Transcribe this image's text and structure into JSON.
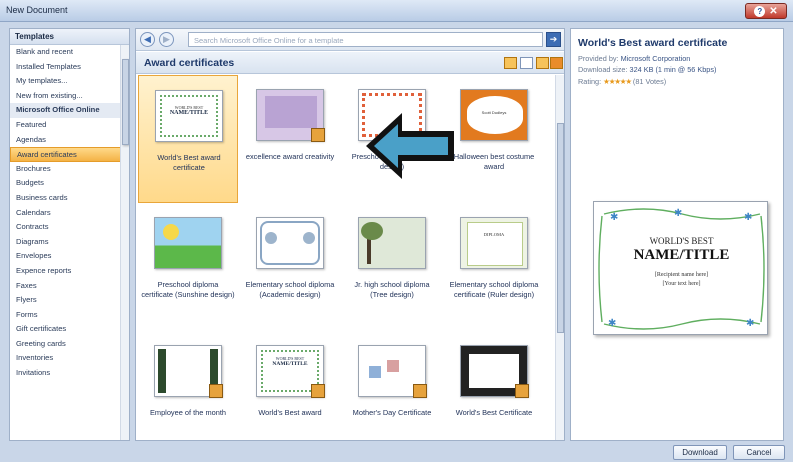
{
  "window": {
    "title": "New Document"
  },
  "sidebar": {
    "header": "Templates",
    "items": [
      {
        "label": "Blank and recent",
        "state": ""
      },
      {
        "label": "Installed Templates",
        "state": ""
      },
      {
        "label": "My templates...",
        "state": ""
      },
      {
        "label": "New from existing...",
        "state": ""
      },
      {
        "label": "Microsoft Office Online",
        "state": "bold"
      },
      {
        "label": "Featured",
        "state": ""
      },
      {
        "label": "Agendas",
        "state": ""
      },
      {
        "label": "Award certificates",
        "state": "sel"
      },
      {
        "label": "Brochures",
        "state": ""
      },
      {
        "label": "Budgets",
        "state": ""
      },
      {
        "label": "Business cards",
        "state": ""
      },
      {
        "label": "Calendars",
        "state": ""
      },
      {
        "label": "Contracts",
        "state": ""
      },
      {
        "label": "Diagrams",
        "state": ""
      },
      {
        "label": "Envelopes",
        "state": ""
      },
      {
        "label": "Expence reports",
        "state": ""
      },
      {
        "label": "Faxes",
        "state": ""
      },
      {
        "label": "Flyers",
        "state": ""
      },
      {
        "label": "Forms",
        "state": ""
      },
      {
        "label": "Gift certificates",
        "state": ""
      },
      {
        "label": "Greeting cards",
        "state": ""
      },
      {
        "label": "Inventories",
        "state": ""
      },
      {
        "label": "Invitations",
        "state": ""
      }
    ]
  },
  "search": {
    "back_icon": "back-arrow-icon",
    "forward_icon": "forward-arrow-icon",
    "placeholder": "Search Microsoft Office Online for a template",
    "go_icon": "go-arrow-icon"
  },
  "gallery": {
    "title": "Award certificates",
    "tiles": [
      {
        "label": "World's Best award certificate",
        "selected": true
      },
      {
        "label": "excellence award creativity"
      },
      {
        "label": "Preschool diploma (Dots design)"
      },
      {
        "label": "Halloween best costume award"
      },
      {
        "label": "Preschool diploma certificate (Sunshine design)"
      },
      {
        "label": "Elementary school diploma (Academic design)"
      },
      {
        "label": "Jr. high school diploma (Tree design)"
      },
      {
        "label": "Elementary school diploma certificate (Ruler design)"
      },
      {
        "label": "Employee of the month"
      },
      {
        "label": "World's Best award"
      },
      {
        "label": "Mother's Day Certificate"
      },
      {
        "label": "World's Best Certificate"
      }
    ]
  },
  "details": {
    "title": "World's Best award certificate",
    "provided_label": "Provided by:",
    "provided_value": "Microsoft Corporation",
    "size_label": "Download size:",
    "size_value": "324 KB (1 min @ 56 Kbps)",
    "rating_label": "Rating:",
    "rating_stars": "★★★★★",
    "rating_votes": "(81 Votes)",
    "preview": {
      "line1": "WORLD'S BEST",
      "line2": "NAME/TITLE",
      "line3": "[Recipient name here]",
      "line4": "[Your text here]"
    }
  },
  "thumb_text": {
    "small1": "WORLD'S BEST",
    "small2": "NAME/TITLE",
    "costume": "Scott Dudleys",
    "diploma": "DIPLOMA"
  },
  "footer": {
    "download": "Download",
    "cancel": "Cancel"
  },
  "colors": {
    "selected": "#f4b246",
    "accent": "#1f3a6b",
    "arrow": "#4aa0c8"
  }
}
